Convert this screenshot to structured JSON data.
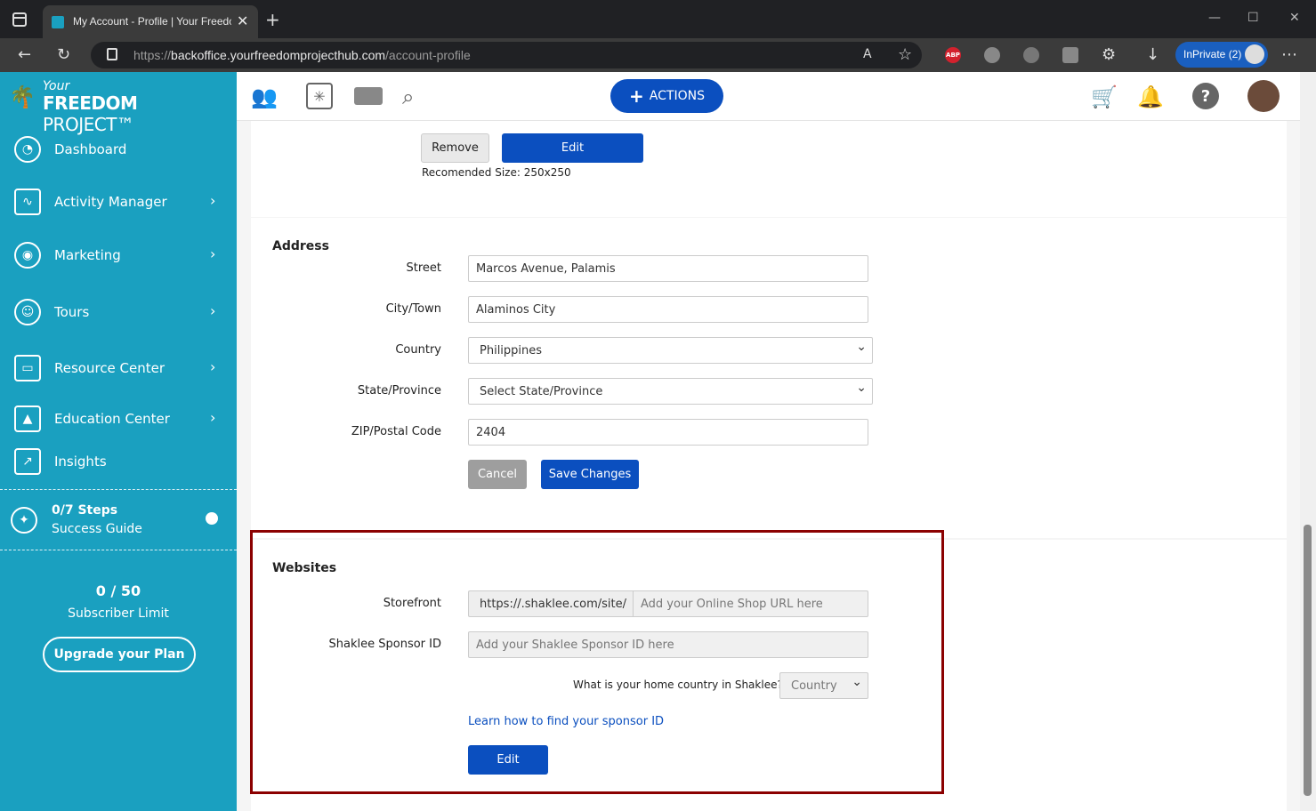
{
  "browser": {
    "tab_title": "My Account - Profile | Your Freedom Project",
    "url_prefix": "https://",
    "url_host": "backoffice.yourfreedomprojecthub.com",
    "url_path": "/account-profile",
    "inprivate_label": "InPrivate (2)",
    "ext_abp": "ABP"
  },
  "header": {
    "actions_label": "ACTIONS"
  },
  "sidebar": {
    "logo_your": "Your",
    "logo_freedom": "FREEDOM",
    "logo_project": "PROJECT™",
    "items": [
      {
        "label": "Dashboard"
      },
      {
        "label": "Activity Manager"
      },
      {
        "label": "Marketing"
      },
      {
        "label": "Tours"
      },
      {
        "label": "Resource Center"
      },
      {
        "label": "Education Center"
      },
      {
        "label": "Insights"
      }
    ],
    "guide_steps": "0/7 Steps",
    "guide_label": "Success Guide",
    "subscriber_count": "0 / 50",
    "subscriber_label": "Subscriber Limit",
    "upgrade_label": "Upgrade your Plan"
  },
  "photo": {
    "remove_label": "Remove",
    "edit_label": "Edit",
    "size_note": "Recomended Size: 250x250"
  },
  "address": {
    "title": "Address",
    "street_label": "Street",
    "street_value": "Marcos Avenue, Palamis",
    "city_label": "City/Town",
    "city_value": "Alaminos City",
    "country_label": "Country",
    "country_value": "Philippines",
    "state_label": "State/Province",
    "state_value": "Select State/Province",
    "zip_label": "ZIP/Postal Code",
    "zip_value": "2404",
    "cancel_label": "Cancel",
    "save_label": "Save Changes"
  },
  "websites": {
    "title": "Websites",
    "storefront_label": "Storefront",
    "storefront_prefix": "https://.shaklee.com/site/",
    "storefront_placeholder": "Add your Online Shop URL here",
    "sponsor_label": "Shaklee Sponsor ID",
    "sponsor_placeholder": "Add your Shaklee Sponsor ID here",
    "country_question": "What is your home country in Shaklee?",
    "country_select": "Country",
    "learn_link": "Learn how to find your sponsor ID",
    "edit_label": "Edit"
  }
}
